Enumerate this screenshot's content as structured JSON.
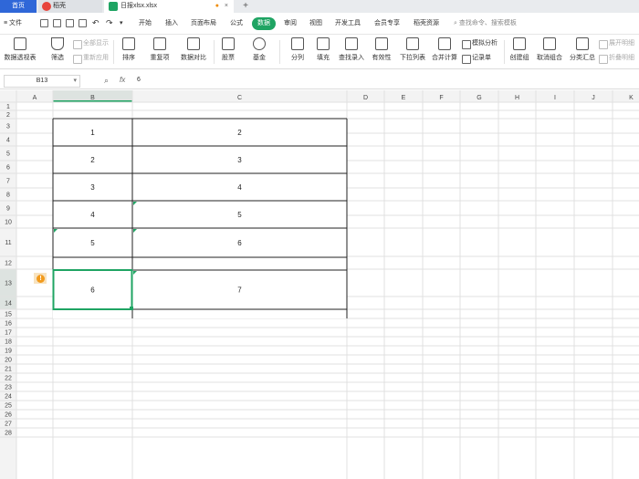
{
  "tabs": {
    "home": "首页",
    "pdf": "稻壳",
    "file": "日报xlsx.xlsx",
    "file_close": "×",
    "add": "+"
  },
  "menu": {
    "file": "≡ 文件",
    "items": [
      "开始",
      "插入",
      "页面布局",
      "公式",
      "数据",
      "审阅",
      "视图",
      "开发工具",
      "会员专享",
      "稻壳资源"
    ],
    "active_index": 4,
    "search": "查找命令、搜索模板"
  },
  "ribbon": {
    "pivot": "数据透视表",
    "filter": "筛选",
    "show_all": "全部显示",
    "reapply": "重新应用",
    "sort": "排序",
    "duplicates": "重复项",
    "compare": "数据对比",
    "stock": "股票",
    "fund": "基金",
    "split": "分列",
    "fill": "填充",
    "lookup": "查找录入",
    "validation": "有效性",
    "dropdown": "下拉列表",
    "consolidate": "合并计算",
    "simulate": "模拟分析",
    "record": "记录单",
    "group": "创建组",
    "ungroup": "取消组合",
    "subtotal": "分类汇总",
    "expand": "展开明细",
    "collapse": "折叠明细"
  },
  "formula_bar": {
    "name_box": "B13",
    "fx": "fx",
    "value": "6"
  },
  "columns": [
    "A",
    "B",
    "C",
    "D",
    "E",
    "F",
    "G",
    "H",
    "I",
    "J",
    "K"
  ],
  "row_numbers": [
    "1",
    "2",
    "3",
    "4",
    "5",
    "6",
    "7",
    "8",
    "9",
    "10",
    "11",
    "12",
    "13",
    "14",
    "15",
    "16",
    "17",
    "18",
    "19",
    "20",
    "21",
    "22",
    "23",
    "24",
    "25",
    "26",
    "27",
    "28"
  ],
  "table_rows": [
    {
      "b": "1",
      "c": "2"
    },
    {
      "b": "2",
      "c": "3"
    },
    {
      "b": "3",
      "c": "4"
    },
    {
      "b": "4",
      "c": "5"
    },
    {
      "b": "5",
      "c": "6"
    },
    {
      "b": "6",
      "c": "7"
    }
  ],
  "selected_cell": "B13",
  "colors": {
    "accent": "#1fa463",
    "tab_home": "#2f67d8",
    "warning": "#f29b1d"
  }
}
